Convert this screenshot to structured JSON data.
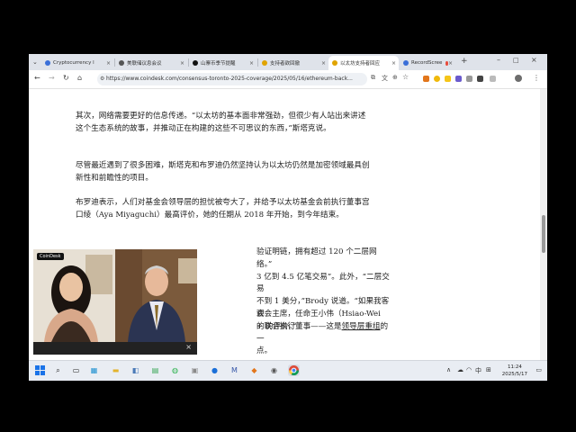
{
  "tabs": [
    {
      "label": "Cryptocurrency l",
      "fav": "#3a6fd8"
    },
    {
      "label": "美联储议息会议",
      "fav": "#555555"
    },
    {
      "label": "山寨币季节提醒",
      "fav": "#111111"
    },
    {
      "label": "支持者欲回撤",
      "fav": "#e0a400"
    },
    {
      "label": "以太坊支持者回应",
      "fav": "#e0a400"
    },
    {
      "label": "RecordScree",
      "fav": "#e84a3a"
    }
  ],
  "browser": {
    "url": "https://www.coindesk.com/consensus-toronto-2025-coverage/2025/05/16/ethereum-back..."
  },
  "article": {
    "p1": "其次，网络需要更好的信息传递。“以太坊的基本面非常强劲，但很少有人站出来讲述这个生态系统的故事，并推动正在构建的这些不可思议的东西，”斯塔克说。",
    "p2": "尽管最近遇到了很多困难，斯塔克和布罗迪仍然坚持认为以太坊仍然是加密领域最具创新性和前瞻性的项目。",
    "p3": "布罗迪表示，人们对基金会领导层的担忧被夸大了，并给予以太坊基金会前执行董事宫口绫（Aya Miyaguchi）最高评价，她的任期从 2018 年开始，到今年结束。",
    "p4_l1": "验证明链，拥有超过 120 个二层网络。”",
    "p4_l2": "3 亿到 4.5 亿笔交易”。此外，“二层交易",
    "p4_l3": "不到 1 美分，”Brody 说道。“如果我客观",
    "p4_l4": "+ 的评价。”",
    "p5_l1": "会会主席，任命王小伟（Hsiao-Wei",
    "p5_l2a": "的联合执行董事——这是",
    "p5_link": "领导层重组",
    "p5_l2b": "的一",
    "p5_l3": "点。"
  },
  "video": {
    "logo": "CoinDesk"
  },
  "taskbar": {
    "time": "11:24",
    "date": "2025/5/17",
    "ime": "中"
  }
}
